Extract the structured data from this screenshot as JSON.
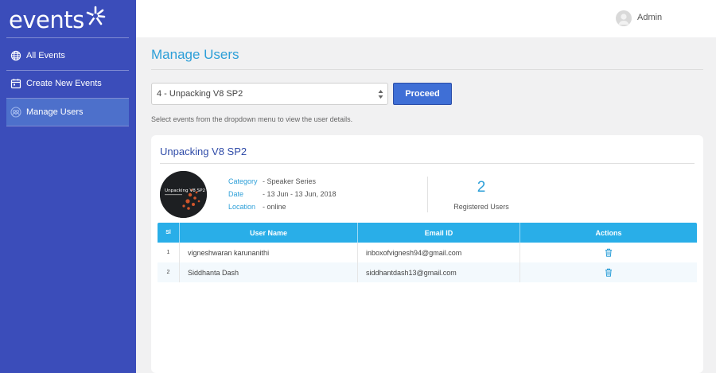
{
  "brand": {
    "name": "events"
  },
  "colors": {
    "sidebar": "#3b4dba",
    "accent": "#2d9fd8",
    "table_header": "#29aee8",
    "button": "#3f6fd6"
  },
  "sidebar": {
    "items": [
      {
        "label": "All Events",
        "icon": "globe-icon",
        "active": false
      },
      {
        "label": "Create New Events",
        "icon": "calendar-icon",
        "active": false
      },
      {
        "label": "Manage Users",
        "icon": "users-icon",
        "active": true
      }
    ]
  },
  "header": {
    "user_name": "Admin",
    "avatar_icon": "user-avatar-icon"
  },
  "page": {
    "title": "Manage Users",
    "event_select": {
      "value": "4 - Unpacking V8 SP2"
    },
    "proceed_label": "Proceed",
    "helper": "Select events from the dropdown menu to view the user details."
  },
  "event": {
    "title": "Unpacking V8 SP2",
    "thumbnail_text": "Unpacking V8 SP2",
    "category_label": "Category",
    "category_value": "- Speaker Series",
    "date_label": "Date",
    "date_value": "- 13 Jun - 13 Jun, 2018",
    "location_label": "Location",
    "location_value": "- online",
    "registered_count": "2",
    "registered_label": "Registered Users"
  },
  "table": {
    "headers": {
      "sl": "Sl",
      "name": "User Name",
      "email": "Email ID",
      "actions": "Actions"
    },
    "rows": [
      {
        "sl": "1",
        "name": "vigneshwaran karunanithi",
        "email": "inboxofvignesh94@gmail.com",
        "action_icon": "trash-icon"
      },
      {
        "sl": "2",
        "name": "Siddhanta Dash",
        "email": "siddhantdash13@gmail.com",
        "action_icon": "trash-icon"
      }
    ]
  }
}
